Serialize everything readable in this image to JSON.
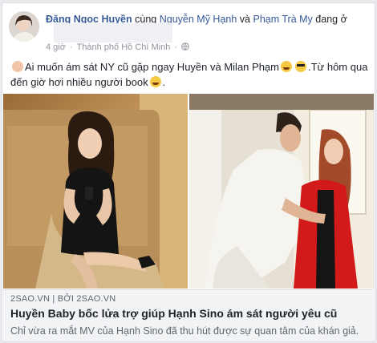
{
  "post": {
    "author": "Đặng Ngọc Huyền",
    "with_text": "cùng",
    "tagged_1": "Nguyễn Mỹ Hạnh",
    "and_text": "và",
    "tagged_2": "Phạm Trà My",
    "status_text": "đang ở",
    "time": "4 giờ",
    "separator": "·",
    "location": "Thành phố Hồ Chí Minh",
    "text_part1": "Ai muốn ám sát NY cũ gặp ngay Huyền và Milan Phạm",
    "text_part2": ".Từ hôm qua đến giờ hơi nhiều người book",
    "text_end": "."
  },
  "link_preview": {
    "domain": "2SAO.VN",
    "by_sep": "|",
    "by_text": "BỞI 2SAO.VN",
    "title": "Huyền Baby bốc lửa trợ giúp Hạnh Sino ám sát người yêu cũ",
    "description": "Chỉ vừa ra mắt MV của Hạnh Sino đã thu hút được sự quan tâm của khán giả."
  },
  "icons": {
    "privacy": "globe-icon",
    "emoji_1": "woman-emoji-icon",
    "emoji_2": "laughing-emoji-icon",
    "emoji_3": "sunglasses-emoji-icon",
    "emoji_4": "laughing-emoji-icon"
  }
}
